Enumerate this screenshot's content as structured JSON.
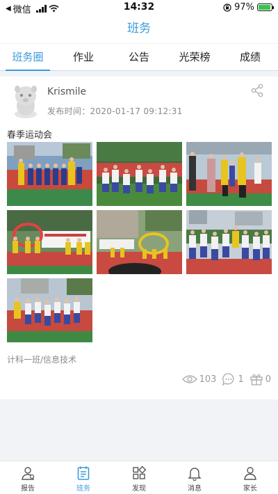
{
  "status_bar": {
    "carrier": "微信",
    "time": "14:32",
    "battery": "97%",
    "battery_level": 0.97
  },
  "nav": {
    "title": "班务"
  },
  "tabs": [
    {
      "label": "班务圈",
      "active": true
    },
    {
      "label": "作业",
      "active": false
    },
    {
      "label": "公告",
      "active": false
    },
    {
      "label": "光荣榜",
      "active": false
    },
    {
      "label": "成绩",
      "active": false
    }
  ],
  "post": {
    "username": "Krismile",
    "time": "发布时间：2020-01-17 09:12:31",
    "title": "春季运动会",
    "class_info": "计科一班/信息技术",
    "views": "103",
    "comments": "1",
    "gifts": "0"
  },
  "bottom_nav": [
    {
      "label": "报告",
      "icon": "person-icon",
      "active": false
    },
    {
      "label": "班务",
      "icon": "clipboard-icon",
      "active": true
    },
    {
      "label": "发现",
      "icon": "grid-icon",
      "active": false
    },
    {
      "label": "消息",
      "icon": "bell-icon",
      "active": false
    },
    {
      "label": "家长",
      "icon": "user-icon",
      "active": false
    }
  ],
  "colors": {
    "accent": "#3a9bdc",
    "text_muted": "#8a8a8a"
  }
}
